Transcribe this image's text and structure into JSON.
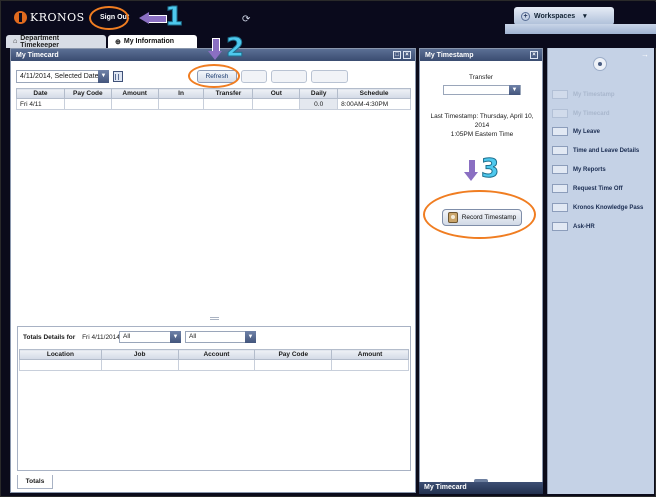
{
  "header": {
    "logo_text": "KRONOS",
    "sign_out_label": "Sign Out",
    "workspaces_label": "Workspaces"
  },
  "tabs": [
    {
      "label": "Department Timekeeper",
      "icon": "home-icon"
    },
    {
      "label": "My Information",
      "icon": "plus-circle-icon"
    }
  ],
  "timecard": {
    "title": "My Timecard",
    "date_selector_value": "4/11/2014, Selected Date",
    "refresh_label": "Refresh",
    "columns": [
      "Date",
      "Pay Code",
      "Amount",
      "In",
      "Transfer",
      "Out",
      "Daily",
      "Schedule"
    ],
    "rows": [
      {
        "date": "Fri 4/11",
        "pay_code": "",
        "amount": "",
        "in": "",
        "transfer": "",
        "out": "",
        "daily": "0.0",
        "schedule": "8:00AM-4:30PM"
      }
    ]
  },
  "totals": {
    "label": "Totals Details for",
    "date": "Fri 4/11/2014",
    "filter_1": "All",
    "filter_2": "All",
    "columns": [
      "Location",
      "Job",
      "Account",
      "Pay Code",
      "Amount"
    ],
    "tab_label": "Totals"
  },
  "timestamp": {
    "title": "My Timestamp",
    "transfer_label": "Transfer",
    "last_line_1": "Last Timestamp: Thursday, April 10, 2014",
    "last_line_2": "1:05PM  Eastern Time",
    "record_label": "Record Timestamp",
    "bottom_label": "My Timecard"
  },
  "sidebar": {
    "items": [
      {
        "label": "My Timestamp",
        "disabled": true
      },
      {
        "label": "My Timecard",
        "disabled": true
      },
      {
        "label": "My Leave",
        "disabled": false
      },
      {
        "label": "Time and Leave Details",
        "disabled": false
      },
      {
        "label": "My Reports",
        "disabled": false
      },
      {
        "label": "Request Time Off",
        "disabled": false
      },
      {
        "label": "Kronos Knowledge Pass",
        "disabled": false
      },
      {
        "label": "Ask-HR",
        "disabled": false
      }
    ]
  },
  "annotations": {
    "step_1": "1",
    "step_2": "2",
    "step_3": "3",
    "accent_orange": "#f07d21",
    "accent_cyan": "#4ec9ee",
    "accent_purple": "#8a6fc2"
  }
}
